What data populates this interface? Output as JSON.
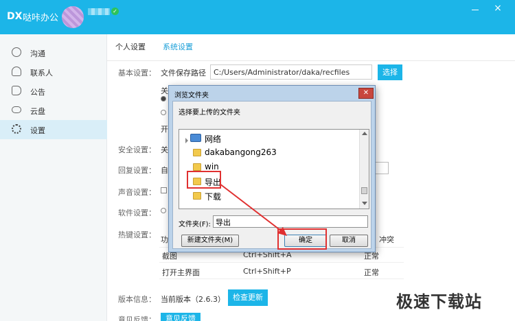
{
  "app": {
    "name": "哒咔办公"
  },
  "sidebar": {
    "items": [
      {
        "label": "沟通",
        "icon": "chat-icon"
      },
      {
        "label": "联系人",
        "icon": "contact-icon"
      },
      {
        "label": "公告",
        "icon": "announcement-icon"
      },
      {
        "label": "云盘",
        "icon": "cloud-icon"
      },
      {
        "label": "设置",
        "icon": "gear-icon",
        "active": true
      }
    ]
  },
  "tabs": {
    "personal": "个人设置",
    "system": "系统设置"
  },
  "settings": {
    "basic_label": "基本设置：",
    "save_path_label": "文件保存路径",
    "save_path_value": "C:/Users/Administrator/daka/recfiles",
    "select_button": "选择",
    "partial_1": "关",
    "partial_2": "开",
    "security_label": "安全设置：",
    "security_partial": "关",
    "reply_label": "回复设置：",
    "reply_partial": "自",
    "sound_label": "声音设置：",
    "software_label": "软件设置：",
    "hotkey_label": "热键设置：",
    "hotkey_col_partial": "功",
    "hotkey_conflict_head": "冲突",
    "hotkey_rows": [
      {
        "name": "截图",
        "keys": "Ctrl+Shift+A",
        "status": "正常"
      },
      {
        "name": "打开主界面",
        "keys": "Ctrl+Shift+P",
        "status": "正常"
      }
    ],
    "version_label": "版本信息：",
    "version_text": "当前版本（2.6.3）",
    "check_update": "检查更新",
    "feedback_label": "意见反馈：",
    "feedback_button": "意见反馈"
  },
  "dialog": {
    "title": "浏览文件夹",
    "close": "✕",
    "prompt": "选择要上传的文件夹",
    "tree": [
      "网络",
      "dakabangong263",
      "win",
      "导出",
      "下载"
    ],
    "folder_label": "文件夹(F):",
    "folder_value": "导出",
    "new_folder": "新建文件夹(M)",
    "ok": "确定",
    "cancel": "取消"
  },
  "watermark": "极速下载站",
  "colors": {
    "accent": "#1cb5e8",
    "highlight": "#e03030"
  }
}
